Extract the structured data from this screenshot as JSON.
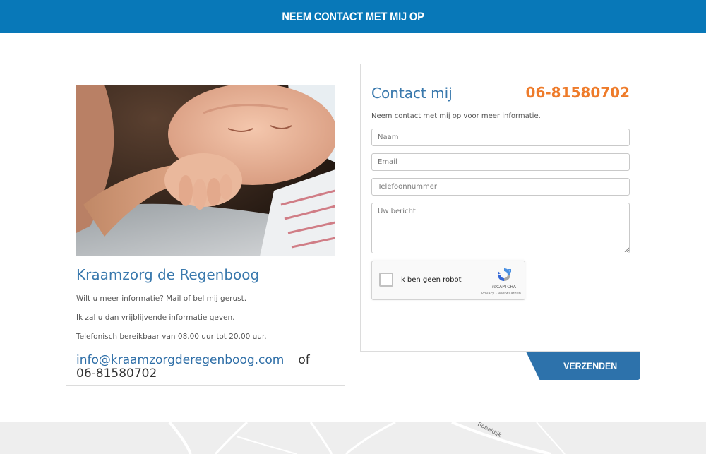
{
  "header": {
    "title": "NEEM CONTACT MET MIJ OP"
  },
  "info_card": {
    "photo_icon": "newborn-photo",
    "title": "Kraamzorg de Regenboog",
    "lines": [
      "Wilt u meer informatie? Mail of bel mij gerust.",
      "Ik zal u dan vrijblijvende informatie geven.",
      "Telefonisch bereikbaar van 08.00 uur tot 20.00 uur."
    ],
    "email": "info@kraamzorgderegenboog.com",
    "or": "of",
    "phone": "06-81580702"
  },
  "contact_form": {
    "title": "Contact mij",
    "phone": "06-81580702",
    "intro": "Neem contact met mij op voor meer informatie.",
    "fields": {
      "name_placeholder": "Naam",
      "email_placeholder": "Email",
      "phone_placeholder": "Telefoonnummer",
      "message_placeholder": "Uw bericht"
    },
    "captcha": {
      "label": "Ik ben geen robot",
      "brand": "reCAPTCHA",
      "terms": "Privacy - Voorwaarden"
    },
    "submit_label": "VERZENDEN"
  },
  "map": {
    "labels": [
      "Bobeldijk"
    ]
  },
  "colors": {
    "header_bg": "#0878b8",
    "accent_blue": "#3a79ad",
    "phone_orange": "#ee7b2a",
    "button_bg": "#2d72ab"
  }
}
